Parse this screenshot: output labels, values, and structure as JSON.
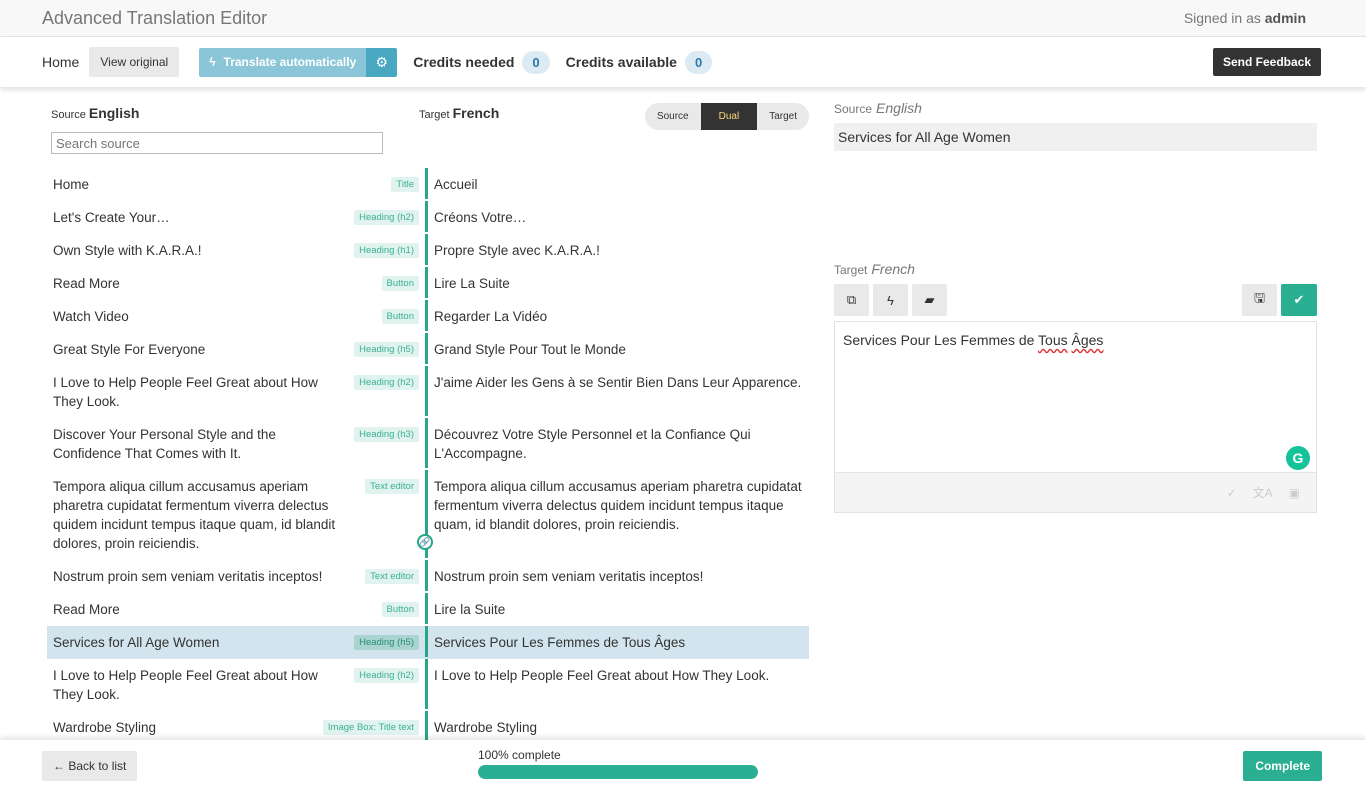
{
  "app": {
    "title": "Advanced Translation Editor",
    "signed_in_prefix": "Signed in as",
    "user": "admin"
  },
  "toolbar": {
    "home": "Home",
    "view_original": "View original",
    "translate_auto": "Translate automatically",
    "credits_needed_label": "Credits needed",
    "credits_needed": "0",
    "credits_available_label": "Credits available",
    "credits_available": "0",
    "send_feedback": "Send Feedback"
  },
  "list": {
    "source_label": "Source",
    "source_lang": "English",
    "target_label": "Target",
    "target_lang": "French",
    "search_placeholder": "Search source",
    "view_modes": [
      "Source",
      "Dual",
      "Target"
    ],
    "active_view": "Dual",
    "rows": [
      {
        "source": "Home",
        "tag": "Title",
        "target": "Accueil"
      },
      {
        "source": "Let's Create Your…",
        "tag": "Heading (h2)",
        "target": "Créons Votre…"
      },
      {
        "source": "Own Style with K.A.R.A.!",
        "tag": "Heading (h1)",
        "target": "Propre Style avec K.A.R.A.!"
      },
      {
        "source": "Read More",
        "tag": "Button",
        "target": "Lire La Suite"
      },
      {
        "source": "Watch Video",
        "tag": "Button",
        "target": "Regarder La Vidéo"
      },
      {
        "source": "Great Style For Everyone",
        "tag": "Heading (h5)",
        "target": "Grand Style Pour Tout le Monde"
      },
      {
        "source": "I Love to Help People Feel Great about How They Look.",
        "tag": "Heading (h2)",
        "target": "J'aime Aider les Gens à se Sentir Bien Dans Leur Apparence."
      },
      {
        "source": "Discover Your Personal Style and the Confidence That Comes with It.",
        "tag": "Heading (h3)",
        "target": "Découvrez Votre Style Personnel et la Confiance Qui L'Accompagne."
      },
      {
        "source": "Tempora aliqua cillum accusamus aperiam pharetra cupidatat fermentum viverra delectus quidem incidunt tempus itaque quam, id blandit dolores, proin reiciendis.",
        "tag": "Text editor",
        "target": "Tempora aliqua cillum accusamus aperiam pharetra cupidatat fermentum viverra delectus quidem incidunt tempus itaque quam, id blandit dolores, proin reiciendis."
      },
      {
        "source": "Nostrum proin sem veniam veritatis inceptos!",
        "tag": "Text editor",
        "target": "Nostrum proin sem veniam veritatis inceptos!"
      },
      {
        "source": "Read More",
        "tag": "Button",
        "target": "Lire la Suite"
      },
      {
        "source": "Services for All Age Women",
        "tag": "Heading (h5)",
        "target": "Services Pour Les Femmes de Tous Âges",
        "selected": true
      },
      {
        "source": "I Love to Help People Feel Great about How They Look.",
        "tag": "Heading (h2)",
        "target": "I Love to Help People Feel Great about How They Look."
      },
      {
        "source": "Wardrobe Styling",
        "tag": "Image Box: Title text",
        "target": "Wardrobe Styling"
      }
    ]
  },
  "detail": {
    "source_label": "Source",
    "source_lang": "English",
    "source_text": "Services for All Age Women",
    "target_label": "Target",
    "target_lang": "French",
    "target_text_plain": "Services Pour Les Femmes de ",
    "target_text_flagged1": "Tous",
    "target_text_flagged2": "Âges"
  },
  "footer": {
    "back": "← Back to list",
    "progress_label": "100% complete",
    "progress": 100,
    "complete": "Complete"
  },
  "colors": {
    "accent": "#2aaf92",
    "info": "#4aa7c1",
    "selected_row": "#d2e4ee"
  }
}
